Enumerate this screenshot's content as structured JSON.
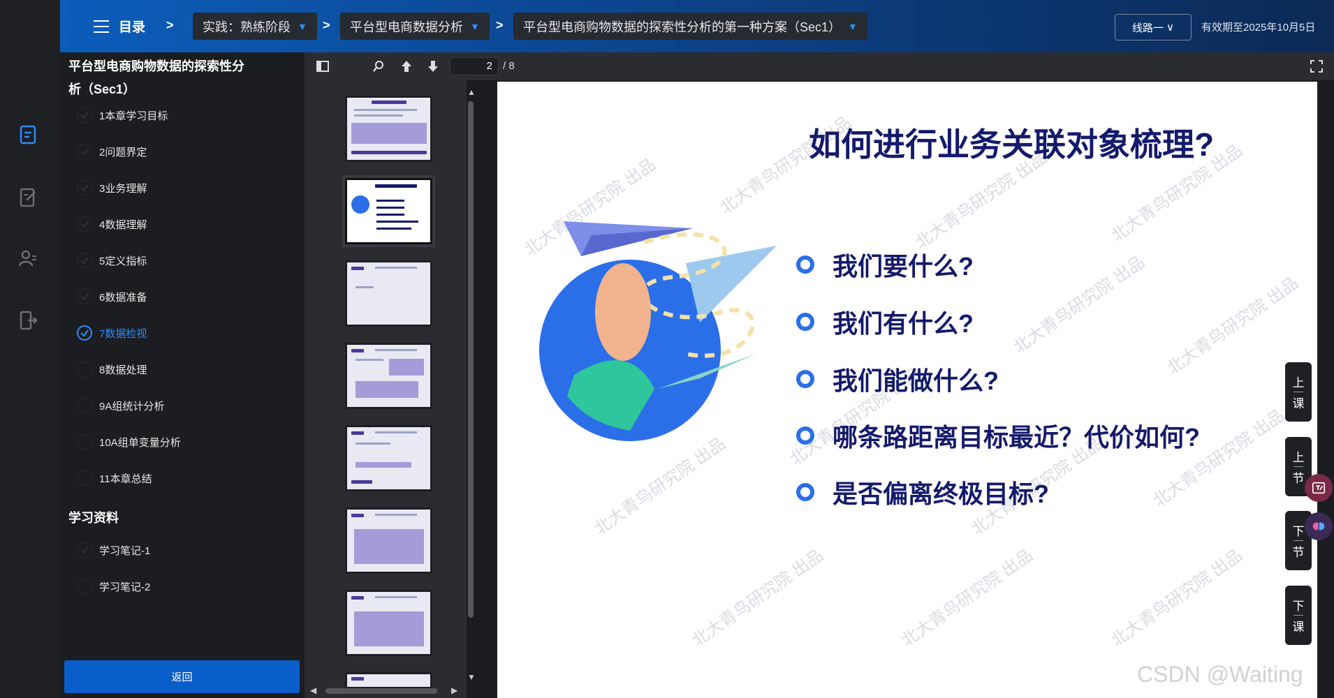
{
  "topbar": {
    "menu_label": "目录",
    "sep": ">",
    "crumbs": [
      "实践：熟练阶段",
      "平台型电商数据分析",
      "平台型电商购物数据的探索性分析的第一种方案（Sec1）"
    ],
    "caret": "▼",
    "route_label": "线路一",
    "route_caret": "∨",
    "valid_text": "有效期至2025年10月5日"
  },
  "course": {
    "title": "平台型电商购物数据的探索性分析（Sec1）",
    "items": [
      {
        "label": "1本章学习目标"
      },
      {
        "label": "2问题界定"
      },
      {
        "label": "3业务理解"
      },
      {
        "label": "4数据理解"
      },
      {
        "label": "5定义指标"
      },
      {
        "label": "6数据准备"
      },
      {
        "label": "7数据检视"
      },
      {
        "label": "8数据处理"
      },
      {
        "label": "9A组统计分析"
      },
      {
        "label": "10A组单变量分析"
      },
      {
        "label": "11本章总结"
      }
    ],
    "materials_title": "学习资料",
    "materials": [
      {
        "label": "学习笔记-1"
      },
      {
        "label": "学习笔记-2"
      }
    ],
    "return_label": "返回"
  },
  "viewer": {
    "current_page": "2",
    "total_pages": "/ 8"
  },
  "slide": {
    "title": "如何进行业务关联对象梳理?",
    "items": [
      "我们要什么?",
      "我们有什么?",
      "我们能做什么?",
      "哪条路距离目标最近？代价如何?",
      "是否偏离终极目标?"
    ],
    "watermark": "北大青鸟研究院 出品"
  },
  "side_nav": {
    "prev_lesson": [
      "上",
      "课"
    ],
    "prev_section": [
      "上",
      "节"
    ],
    "next_section": [
      "下",
      "节"
    ],
    "next_lesson": [
      "下",
      "课"
    ]
  },
  "footer_watermark": "CSDN @Waiting",
  "colors": {
    "accent": "#2c8cff",
    "topbar": "#0b5dba",
    "slide_title": "#141a6b",
    "return_button": "#0a5ec9"
  }
}
